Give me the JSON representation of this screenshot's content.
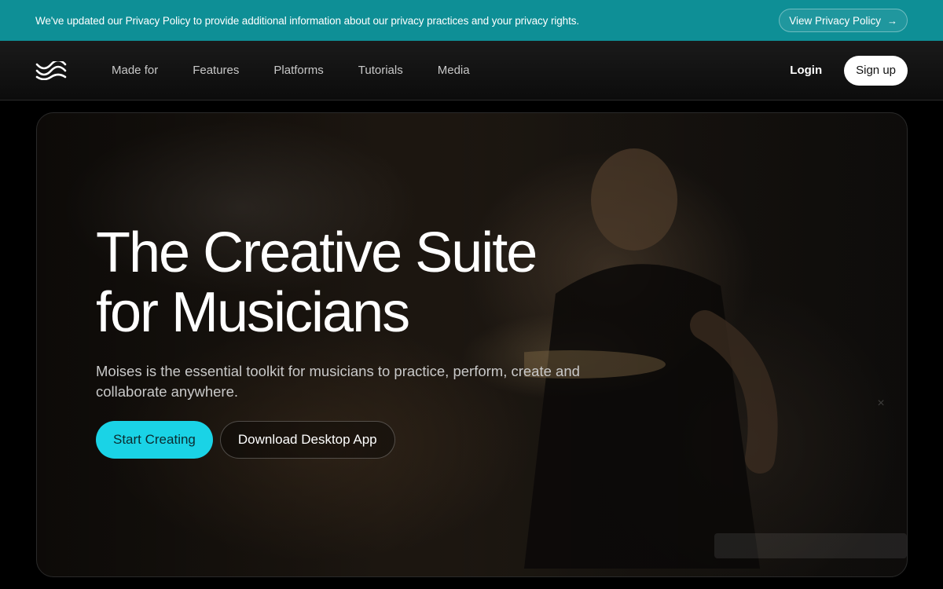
{
  "banner": {
    "text": "We've updated our Privacy Policy to provide additional information about our privacy practices and your privacy rights.",
    "button_label": "View Privacy Policy",
    "button_icon": "arrow-right-icon"
  },
  "nav": {
    "logo_icon": "moises-wave-logo",
    "links": [
      "Made for",
      "Features",
      "Platforms",
      "Tutorials",
      "Media"
    ],
    "login_label": "Login",
    "signup_label": "Sign up"
  },
  "hero": {
    "title_line1": "The Creative Suite",
    "title_line2": "for Musicians",
    "subtitle": "Moises is the essential toolkit for musicians to practice, perform, create and collaborate anywhere.",
    "primary_cta": "Start Creating",
    "secondary_cta": "Download Desktop App"
  },
  "colors": {
    "banner_bg": "#0e8f96",
    "accent": "#1ad3e6",
    "background": "#000000"
  }
}
